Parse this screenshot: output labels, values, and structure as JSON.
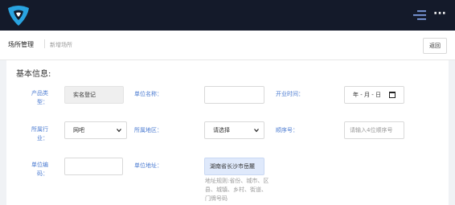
{
  "colors": {
    "topbar": "#141a2a",
    "accent": "#4b7bd1",
    "logo": "#29a3e0"
  },
  "icons": {
    "logo": "app-logo",
    "menu": "menu-lines-icon",
    "more": "more-dots-icon",
    "select": "chevron-down-icon",
    "date": "calendar-icon"
  },
  "header": {
    "more": "···"
  },
  "breadcrumb": {
    "main": "场所管理",
    "sub": "新增场所"
  },
  "toolbar": {
    "back_label": "返回"
  },
  "form": {
    "title": "基本信息:",
    "product_type": {
      "label": "产品类型：",
      "value": "实名登记"
    },
    "unit_name": {
      "label": "单位名称：",
      "value": ""
    },
    "open_time": {
      "label": "开业时间：",
      "value": "年 - 月 - 日"
    },
    "industry": {
      "label": "所属行业：",
      "value": "网吧"
    },
    "region": {
      "label": "所属地区：",
      "value": "请选择"
    },
    "serial": {
      "label": "顺序号：",
      "placeholder": "请输入4位顺序号"
    },
    "unit_code": {
      "label": "单位编码：",
      "value": ""
    },
    "unit_address": {
      "label": "单位地址：",
      "value": "湖南省长沙市岳麓",
      "hint": "地址规则:省份、城市、区县、城镇、乡村、街道、门牌号码"
    }
  }
}
